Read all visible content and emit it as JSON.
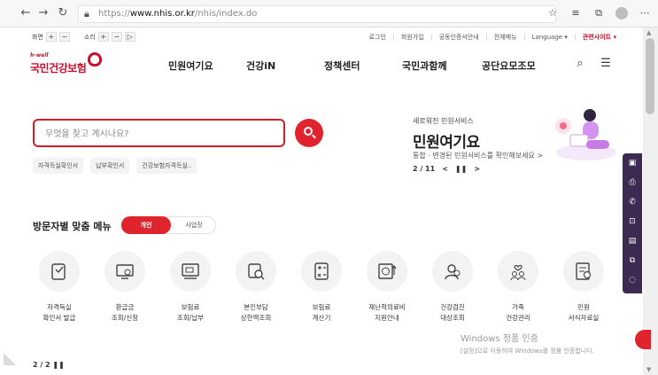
{
  "browser": {
    "url_prefix": "https://",
    "url_domain": "www.nhis.or.kr",
    "url_path": "/nhis/index.do"
  },
  "utility": {
    "screen_label": "화면",
    "sound_label": "소리",
    "plus": "+",
    "minus": "−",
    "play": "▷",
    "links": [
      "로그인",
      "회원가입",
      "공동인증서안내",
      "전체메뉴",
      "Language ▾"
    ],
    "related_sites": "관련사이트 ▾"
  },
  "header": {
    "logo_sub": "h-well",
    "logo_name": "국민건강보험",
    "nav": [
      "민원여기요",
      "건강iN",
      "정책센터",
      "국민과함께",
      "공단요모조모"
    ]
  },
  "search": {
    "placeholder": "무엇을 찾고 계시나요?",
    "quick_tags": [
      "자격득실확인서",
      "납부확인서",
      "건강보험자격득실.."
    ]
  },
  "promo": {
    "small": "새로워진 민원서비스",
    "title": "민원여기요",
    "desc": "통합 · 변경된 민원서비스를 확인해보세요 >",
    "page": "2 / 11",
    "prev": "<",
    "pause": "❚❚",
    "next": ">"
  },
  "visitor_menu": {
    "title": "방문자별 맞춤 메뉴",
    "tab_personal": "개인",
    "tab_business": "사업장",
    "items": [
      {
        "line1": "자격득실",
        "line2": "확인서 발급",
        "icon": "certificate-icon"
      },
      {
        "line1": "환급금",
        "line2": "조회/신청",
        "icon": "refund-icon"
      },
      {
        "line1": "보험료",
        "line2": "조회/납부",
        "icon": "payment-icon"
      },
      {
        "line1": "본인부담",
        "line2": "상한액조회",
        "icon": "medical-search-icon"
      },
      {
        "line1": "보험료",
        "line2": "계산기",
        "icon": "calculator-icon"
      },
      {
        "line1": "재난적의료비",
        "line2": "지원안내",
        "icon": "support-icon"
      },
      {
        "line1": "건강검진",
        "line2": "대상조회",
        "icon": "checkup-icon"
      },
      {
        "line1": "가족",
        "line2": "건강관리",
        "icon": "family-icon"
      },
      {
        "line1": "민원",
        "line2": "서식자료실",
        "icon": "document-icon"
      }
    ],
    "page_indicator": "2 / 2   ❚❚"
  },
  "watermark": {
    "line1": "Windows 정품 인증",
    "line2": "[설정]으로 이동하여 Windows를 정품 인증합니다."
  },
  "colors": {
    "brand_red": "#e0242d",
    "dock_purple": "#3c2a50"
  }
}
